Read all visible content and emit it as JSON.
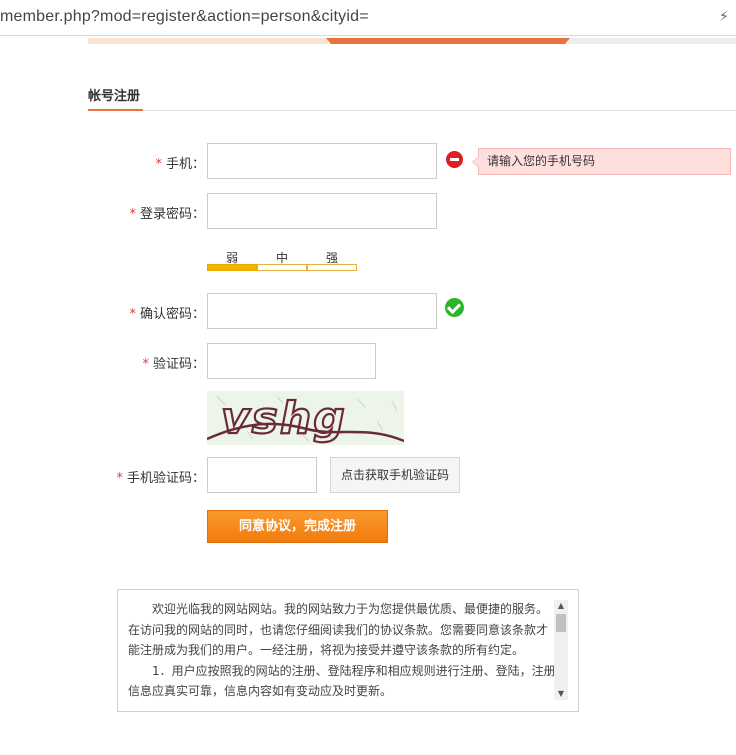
{
  "browser": {
    "url": "member.php?mod=register&action=person&cityid=",
    "bolt_glyph": "⚡"
  },
  "colors": {
    "accent": "#e8743b",
    "error": "#e02020",
    "success": "#2bb52b",
    "submit": "#f28a1b"
  },
  "tab": {
    "title": "帐号注册"
  },
  "form": {
    "required_mark": "*",
    "phone": {
      "label": "手机：",
      "value": ""
    },
    "phone_error": "请输入您的手机号码",
    "password": {
      "label": "登录密码：",
      "value": ""
    },
    "strength": {
      "labels": [
        "弱",
        "中",
        "强"
      ],
      "level": 1
    },
    "confirm": {
      "label": "确认密码：",
      "value": ""
    },
    "captcha": {
      "label": "验证码：",
      "value": "",
      "image_text": "vshg"
    },
    "sms": {
      "label": "手机验证码：",
      "value": "",
      "button": "点击获取手机验证码"
    },
    "submit": "同意协议，完成注册"
  },
  "agreement": {
    "paragraphs": [
      "欢迎光临我的网站网站。我的网站致力于为您提供最优质、最便捷的服务。在访问我的网站的同时，也请您仔细阅读我们的协议条款。您需要同意该条款才能注册成为我们的用户。一经注册，将视为接受并遵守该条款的所有约定。",
      "1．用户应按照我的网站的注册、登陆程序和相应规则进行注册、登陆，注册信息应真实可靠，信息内容如有变动应及时更新。"
    ]
  }
}
